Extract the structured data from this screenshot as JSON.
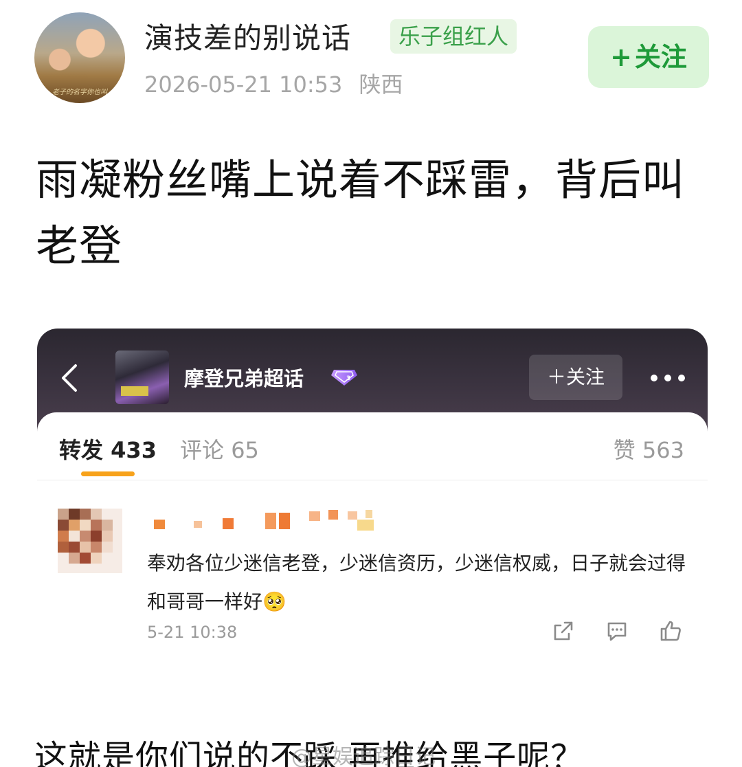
{
  "post": {
    "author": {
      "name": "演技差的别说话",
      "badge": "乐子组红人",
      "avatar_caption": "老子的名字你也叫"
    },
    "timestamp": "2026-05-21 10:53",
    "location": "陕西",
    "follow_plus": "+",
    "follow_label": "关注",
    "text": "雨凝粉丝嘴上说着不踩雷，背后叫老登",
    "footer_text": "这就是你们说的不踩 再推给黑子呢？",
    "watermark": "@星娱追踪日记"
  },
  "embed": {
    "topic_name": "摩登兄弟超话",
    "follow_label": "＋关注",
    "tabs": {
      "repost_label": "转发",
      "repost_count": "433",
      "comment_label": "评论",
      "comment_count": "65",
      "like_label": "赞",
      "like_count": "563"
    },
    "comment": {
      "text": "奉劝各位少迷信老登，少迷信资历，少迷信权威，日子就会过得和哥哥一样好",
      "emoji": "🥺",
      "time": "5-21 10:38"
    }
  },
  "colors": {
    "accent_green": "#1e9a39",
    "badge_green": "#3aa04a",
    "tab_underline": "#f7a21b",
    "embed_header": "#3b3340"
  },
  "icons": [
    "back-icon",
    "vip-icon",
    "more-icon",
    "share-icon",
    "comment-icon",
    "like-icon"
  ]
}
